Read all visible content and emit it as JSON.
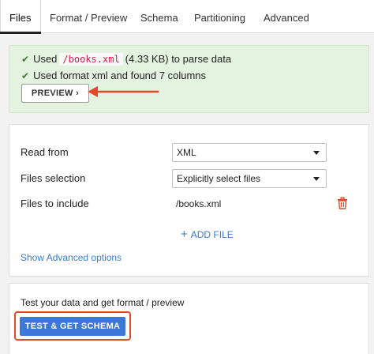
{
  "tabs": [
    {
      "label": "Files",
      "active": true
    },
    {
      "label": "Format / Preview"
    },
    {
      "label": "Schema"
    },
    {
      "label": "Partitioning"
    },
    {
      "label": "Advanced"
    }
  ],
  "status": {
    "line1_prefix": "Used",
    "line1_file": "/books.xml",
    "line1_suffix": "(4.33 KB) to parse data",
    "line2": "Used format xml and found 7 columns",
    "preview_label": "PREVIEW",
    "preview_chevron": "›",
    "check_icon": "check-icon",
    "success_color": "#3a7d2c"
  },
  "settings": {
    "read_from_label": "Read from",
    "read_from_value": "XML",
    "files_selection_label": "Files selection",
    "files_selection_value": "Explicitly select files",
    "files_to_include_label": "Files to include",
    "files": [
      "/books.xml"
    ],
    "add_file_label": "ADD FILE",
    "show_advanced_label": "Show Advanced options"
  },
  "test": {
    "prompt": "Test your data and get format / preview",
    "button_label": "TEST & GET SCHEMA"
  },
  "colors": {
    "accent": "#3c78d8",
    "link": "#3b7bd2",
    "annotation": "#e2492a",
    "success_bg": "#e4f3df"
  }
}
